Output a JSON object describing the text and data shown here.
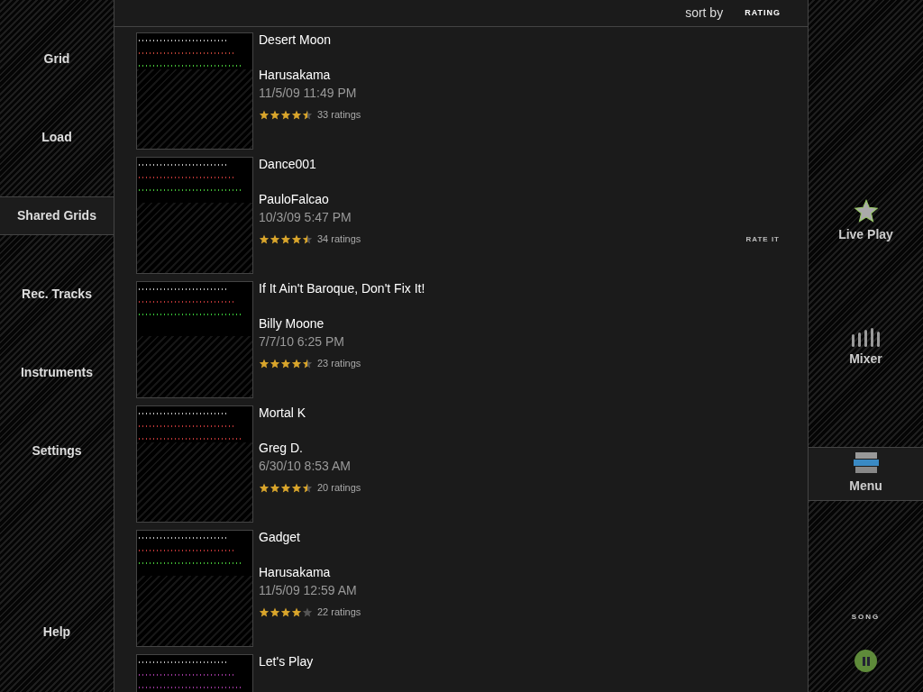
{
  "left_nav": [
    {
      "label": "Grid",
      "selected": false
    },
    {
      "label": "Load",
      "selected": false
    },
    {
      "label": "Shared Grids",
      "selected": true
    },
    {
      "label": "Rec. Tracks",
      "selected": false
    },
    {
      "label": "Instruments",
      "selected": false
    },
    {
      "label": "Settings",
      "selected": false
    },
    {
      "label": "Help",
      "selected": false
    }
  ],
  "header": {
    "sort_label": "sort by",
    "sort_value": "RATING"
  },
  "grids": [
    {
      "title": "Desert Moon",
      "author": "Harusakama",
      "date": "11/5/09 11:49 PM",
      "stars": 4.5,
      "ratings": "33 ratings"
    },
    {
      "title": "Dance001",
      "author": "PauloFalcao",
      "date": "10/3/09 5:47 PM",
      "stars": 4.5,
      "ratings": "34 ratings",
      "action": "RATE IT"
    },
    {
      "title": "If It Ain't Baroque, Don't Fix It!",
      "author": "Billy Moone",
      "date": "7/7/10 6:25 PM",
      "stars": 4.5,
      "ratings": "23 ratings"
    },
    {
      "title": "Mortal K",
      "author": "Greg D.",
      "date": "6/30/10 8:53 AM",
      "stars": 4.5,
      "ratings": "20 ratings"
    },
    {
      "title": "Gadget",
      "author": "Harusakama",
      "date": "11/5/09 12:59 AM",
      "stars": 4,
      "ratings": "22 ratings"
    },
    {
      "title": "Let's Play"
    }
  ],
  "right_nav": [
    {
      "kind": "star",
      "label": "Live Play",
      "selected": false
    },
    {
      "kind": "mixer",
      "label": "Mixer",
      "selected": false
    },
    {
      "kind": "menu",
      "label": "Menu",
      "selected": true
    }
  ],
  "song": {
    "label": "SONG"
  }
}
